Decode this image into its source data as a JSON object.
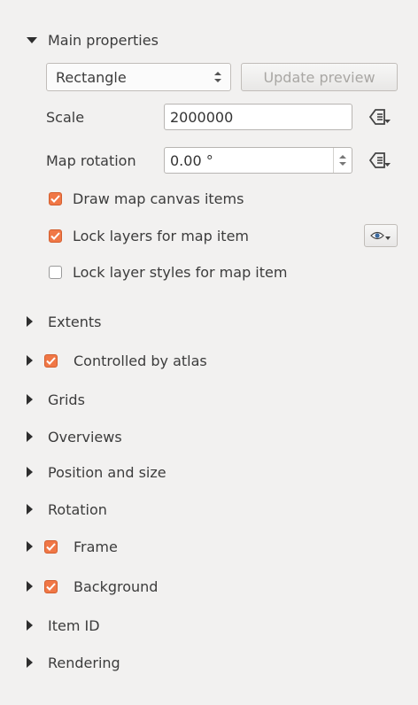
{
  "main": {
    "title": "Main properties",
    "preview_mode": "Rectangle",
    "update_preview_label": "Update preview",
    "scale_label": "Scale",
    "scale_value": "2000000",
    "rotation_label": "Map rotation",
    "rotation_value": "0.00 °",
    "draw_canvas_label": "Draw map canvas items",
    "lock_layers_label": "Lock layers for map item",
    "lock_styles_label": "Lock layer styles for map item"
  },
  "sections": {
    "extents": "Extents",
    "atlas": "Controlled by atlas",
    "grids": "Grids",
    "overviews": "Overviews",
    "position": "Position and size",
    "rotation": "Rotation",
    "frame": "Frame",
    "background": "Background",
    "item_id": "Item ID",
    "rendering": "Rendering"
  },
  "colors": {
    "checkbox_on": "#f07746",
    "panel_bg": "#f2f1f0"
  }
}
